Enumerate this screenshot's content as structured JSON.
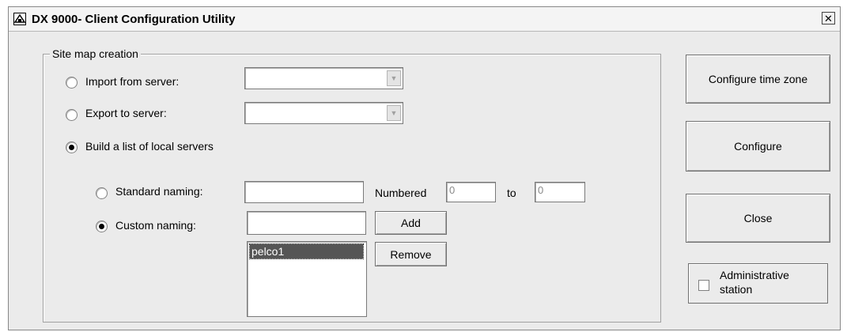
{
  "window": {
    "title": "DX 9000- Client Configuration Utility",
    "close_glyph": "✕",
    "app_icon": "app-icon"
  },
  "site_map": {
    "group_label": "Site map creation",
    "import_label": "Import from server:",
    "import_value": "",
    "import_checked": false,
    "export_label": "Export to server:",
    "export_value": "",
    "export_checked": false,
    "build_label": "Build a list of local servers",
    "build_checked": true,
    "standard_label": "Standard naming:",
    "standard_value": "",
    "standard_checked": false,
    "numbered_label": "Numbered",
    "numbered_from": "0",
    "to_label": "to",
    "numbered_to": "0",
    "custom_label": "Custom naming:",
    "custom_value": "",
    "custom_checked": true,
    "add_label": "Add",
    "remove_label": "Remove",
    "server_list": [
      "pelco1"
    ]
  },
  "buttons": {
    "configure_time_zone": "Configure time zone",
    "configure": "Configure",
    "close": "Close"
  },
  "admin": {
    "label_line1": "Administrative",
    "label_line2": "station",
    "checked": false
  }
}
